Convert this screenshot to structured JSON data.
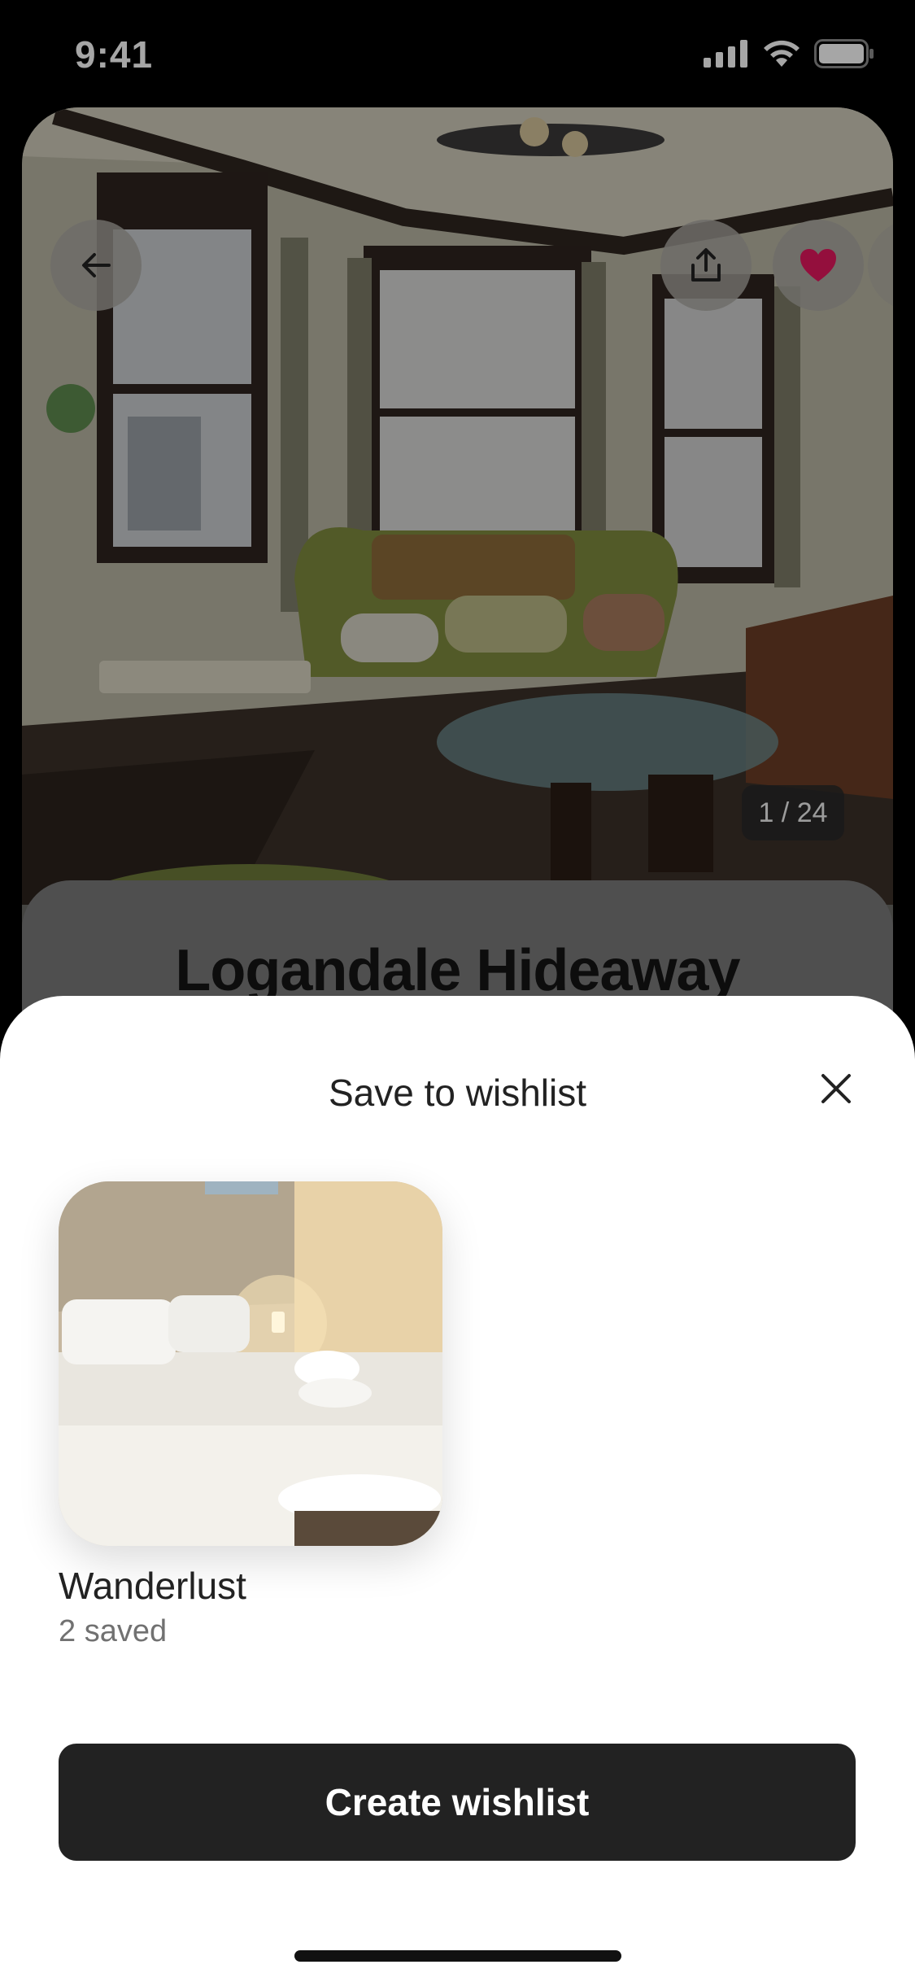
{
  "status_bar": {
    "time": "9:41"
  },
  "listing": {
    "title": "Logandale Hideaway",
    "photo_counter": "1 / 24",
    "favorited": true,
    "heart_color": "#E3175E"
  },
  "sheet": {
    "title": "Save to wishlist",
    "wishlists": [
      {
        "name": "Wanderlust",
        "saved_count": "2 saved"
      }
    ],
    "create_button_label": "Create wishlist"
  },
  "icons": {
    "back": "arrow-left-icon",
    "share": "share-icon",
    "favorite": "heart-icon",
    "close": "close-icon"
  }
}
